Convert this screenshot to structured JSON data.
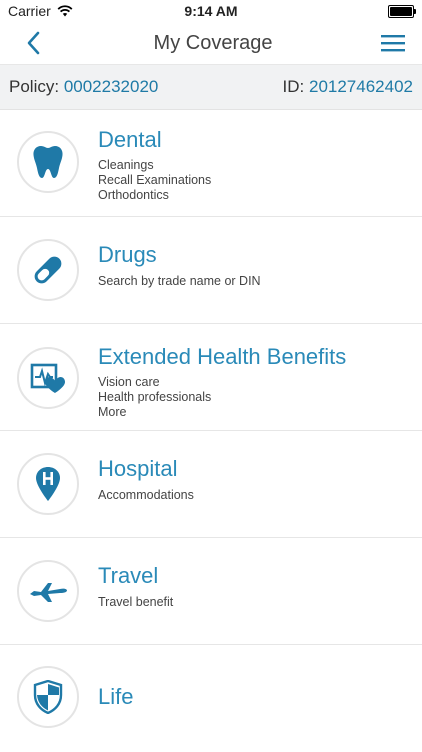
{
  "status": {
    "carrier": "Carrier",
    "time": "9:14 AM"
  },
  "nav": {
    "title": "My Coverage"
  },
  "policy": {
    "policy_label": "Policy:",
    "policy_value": "0002232020",
    "id_label": "ID:",
    "id_value": "20127462402"
  },
  "items": [
    {
      "title": "Dental",
      "lines": [
        "Cleanings",
        "Recall Examinations",
        "Orthodontics"
      ],
      "icon": "tooth-icon"
    },
    {
      "title": "Drugs",
      "lines": [
        "Search by trade name or DIN"
      ],
      "icon": "pill-icon"
    },
    {
      "title": "Extended Health Benefits",
      "lines": [
        "Vision care",
        "Health professionals",
        "More"
      ],
      "icon": "health-monitor-icon"
    },
    {
      "title": "Hospital",
      "lines": [
        "Accommodations"
      ],
      "icon": "hospital-pin-icon"
    },
    {
      "title": "Travel",
      "lines": [
        "Travel benefit"
      ],
      "icon": "airplane-icon"
    },
    {
      "title": "Life",
      "lines": [],
      "icon": "shield-icon"
    }
  ],
  "colors": {
    "accent": "#2a8ab8",
    "icon_fill": "#1f79a7",
    "policy_bg": "#f1f2f3"
  }
}
